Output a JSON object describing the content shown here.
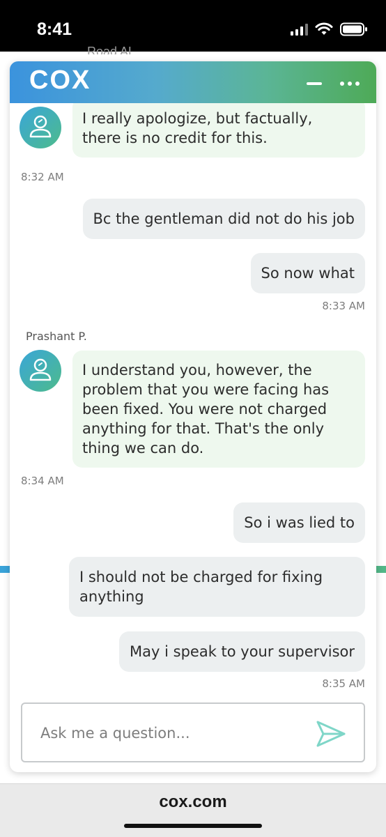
{
  "status_bar": {
    "time": "8:41"
  },
  "background": {
    "partial_text": "Road AL"
  },
  "widget": {
    "logo": "COX",
    "brand_gradient": [
      "#3b93dd",
      "#4eaa57"
    ]
  },
  "messages": [
    {
      "sender": "agent",
      "text": "I really apologize, but factually, there is no credit for this.",
      "time": "8:32 AM"
    },
    {
      "sender": "user",
      "text": "Bc the gentleman did not do his job"
    },
    {
      "sender": "user",
      "text": "So now what",
      "time": "8:33 AM"
    },
    {
      "sender": "agent",
      "name": "Prashant P.",
      "text": "I understand you, however, the problem that you were facing has been fixed. You were not charged anything for that. That's the only thing we can do.",
      "time": "8:34 AM"
    },
    {
      "sender": "user",
      "text": "So i was lied to"
    },
    {
      "sender": "user",
      "text": "I should not be charged for fixing anything"
    },
    {
      "sender": "user",
      "text": "May i speak to your supervisor",
      "time": "8:35 AM"
    }
  ],
  "input": {
    "placeholder": "Ask me a question..."
  },
  "browser": {
    "url": "cox.com"
  },
  "colors": {
    "agent_bubble": "#eef8ee",
    "user_bubble": "#eceff0",
    "send_icon": "#7fd6c8"
  }
}
